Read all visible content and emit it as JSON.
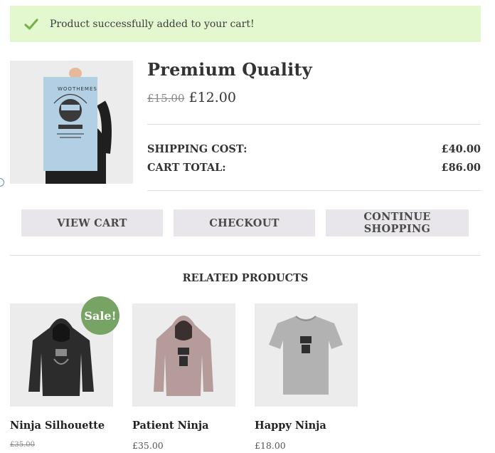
{
  "notice": {
    "message": "Product successfully added to your cart!",
    "icon": "check-icon",
    "color": "#77b14a"
  },
  "product": {
    "title": "Premium Quality",
    "old_price": "£15.00",
    "price": "£12.00",
    "poster_text": "WOOTHEMES"
  },
  "summary": [
    {
      "label": "SHIPPING COST:",
      "value": "£40.00"
    },
    {
      "label": "CART TOTAL:",
      "value": "£86.00"
    }
  ],
  "buttons": {
    "view_cart": "VIEW CART",
    "checkout": "CHECKOUT",
    "continue": "CONTINUE SHOPPING"
  },
  "related": {
    "title": "RELATED PRODUCTS",
    "items": [
      {
        "name": "Ninja Silhouette",
        "price": "£35.00",
        "price_struck": true,
        "badge": "Sale!"
      },
      {
        "name": "Patient Ninja",
        "price": "£35.00"
      },
      {
        "name": "Happy Ninja",
        "price": "£18.00"
      }
    ]
  }
}
